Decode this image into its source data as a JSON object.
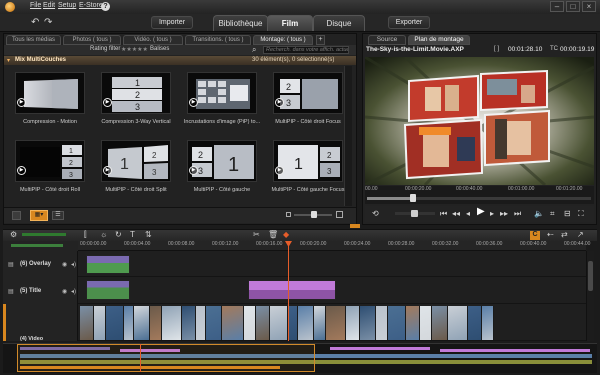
{
  "menu": {
    "items": [
      "File",
      "Edit",
      "Setup",
      "E-Store"
    ],
    "help": "?"
  },
  "main_tabs": {
    "import": "Importer",
    "library": "Bibliothèque",
    "movie": "Film",
    "disc": "Disque",
    "export": "Exporter",
    "active": "Film"
  },
  "library": {
    "tabs": [
      "Tous les médias",
      "Photos ( tous )",
      "Vidéo. ( tous )",
      "Transitions. ( tous )",
      "Montage: ( tous )"
    ],
    "active_tab": "Montage: ( tous )",
    "rating_filter_label": "Rating filter",
    "rating_stars": "★★★★★",
    "tags_label": "Balises",
    "search_placeholder": "Recherch. dans votre affich. actue",
    "collection_name": "Mix MultiCouches",
    "status_text": "30 élément(s), 0 sélectionné(s)",
    "items": [
      {
        "label": "Compression - Motion"
      },
      {
        "label": "Compression 3-Way Vertical"
      },
      {
        "label": "Incrustations d'image (PiP) to..."
      },
      {
        "label": "MultiPIP - Côté droit Focus"
      },
      {
        "label": "MultiPIP - Côté droit Roll"
      },
      {
        "label": "MultiPIP - Côté droit Split"
      },
      {
        "label": "MultiPIP - Côté gauche"
      },
      {
        "label": "MultiPIP - Côté gauche Focus"
      }
    ]
  },
  "preview": {
    "tabs": [
      "Source",
      "Plan de montage"
    ],
    "active_tab": "Plan de montage",
    "title": "The-Sky-is-the-Limit.Movie.AXP",
    "duration_time": "00:01:28.10",
    "tc_label": "TC",
    "timecode": "00:00:19.19",
    "scrub_labels": [
      "00.00",
      "00:00:20.00",
      "00:00:40.00",
      "00:01:00.00",
      "00:01:20.00"
    ]
  },
  "timeline": {
    "ruler_labels": [
      "00:00:00.00",
      "00:00:04.00",
      "00:00:08.00",
      "00:00:12.00",
      "00:00:16.00",
      "00:00:20.00",
      "00:00:24.00",
      "00:00:28.00",
      "00:00:32.00",
      "00:00:36.00",
      "00:00:40.00",
      "00:00:44.00"
    ],
    "tracks": [
      "(6) Overlay",
      "(5) Title",
      "(4) Video"
    ]
  },
  "colors": {
    "accent_orange": "#e8902c",
    "playhead": "#e65d2a",
    "title_clip": "#c07ad8",
    "video_clip": "#5a7fa8",
    "overlay_clip": "#7a6ab0"
  }
}
